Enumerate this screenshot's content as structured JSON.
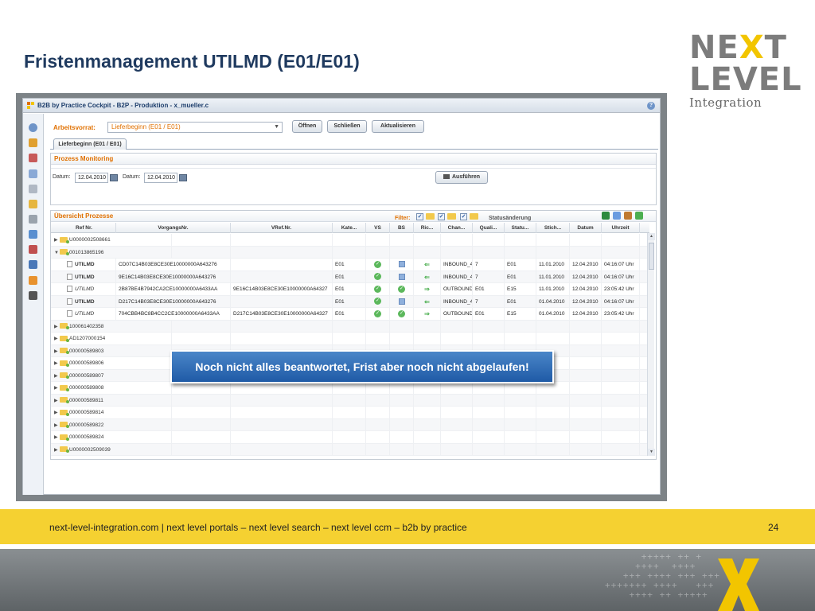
{
  "slide": {
    "title": "Fristenmanagement UTILMD (E01/E01)",
    "logo": {
      "line1_a": "NE",
      "line1_x": "X",
      "line1_b": "T",
      "line2": "LEVEL",
      "line3": "Integration"
    },
    "footer_text": "next-level-integration.com | next level portals –  next level search – next level ccm – b2b by practice",
    "page_number": "24",
    "callout": "Noch nicht alles beantwortet, Frist aber noch nicht abgelaufen!"
  },
  "app": {
    "window_title": "B2B by Practice Cockpit - B2P - Produktion - x_mueller.c",
    "toolbar": {
      "worklist_label": "Arbeitsvorrat:",
      "worklist_value": "Lieferbeginn (E01 / E01)",
      "open_button": "Öffnen",
      "close_button": "Schließen",
      "refresh_button": "Aktualisieren"
    },
    "tab": "Lieferbeginn (E01 / E01)",
    "monitoring": {
      "title": "Prozess Monitoring",
      "date_label_1": "Datum:",
      "date_value_1": "12.04.2010",
      "date_label_2": "Datum:",
      "date_value_2": "12.04.2010",
      "execute_button": "Ausführen"
    },
    "overview": {
      "title": "Übersicht Prozesse",
      "filter_label": "Filter:",
      "status_change_label": "Statusänderung"
    },
    "columns": [
      "Ref Nr.",
      "VorgangsNr.",
      "VRef.Nr.",
      "Kate...",
      "VS",
      "BS",
      "Ric...",
      "Chan...",
      "Quali...",
      "Statu...",
      "Stich...",
      "Datum",
      "Uhrzeit"
    ],
    "rows": [
      {
        "kind": "folder",
        "expanded": false,
        "ref": "U0000002508661"
      },
      {
        "kind": "folder",
        "expanded": true,
        "ref": "001013865196"
      },
      {
        "kind": "doc",
        "style": "bold",
        "ref": "UTILMD",
        "vorgang": "CD07C14B03E8CE30E10000000A643276",
        "vref": "",
        "kat": "E01",
        "vs": "ok",
        "bs": "sq",
        "ric": "in",
        "chan": "INBOUND_4",
        "quali": "7",
        "status": "E01",
        "stich": "11.01.2010",
        "datum": "12.04.2010",
        "uhr": "04:16:07 Uhr"
      },
      {
        "kind": "doc",
        "style": "bold",
        "ref": "UTILMD",
        "vorgang": "9E16C14B03E8CE30E10000000A643276",
        "vref": "",
        "kat": "E01",
        "vs": "ok",
        "bs": "sq",
        "ric": "in",
        "chan": "INBOUND_4",
        "quali": "7",
        "status": "E01",
        "stich": "11.01.2010",
        "datum": "12.04.2010",
        "uhr": "04:16:07 Uhr"
      },
      {
        "kind": "doc",
        "style": "ital",
        "ref": "UTILMD",
        "vorgang": "2B87BE4B7942CA2CE10000000A6433AA",
        "vref": "9E16C14B03E8CE30E10000000A64327",
        "kat": "E01",
        "vs": "ok",
        "bs": "ok",
        "ric": "out",
        "chan": "OUTBOUND",
        "quali": "E01",
        "status": "E15",
        "stich": "11.01.2010",
        "datum": "12.04.2010",
        "uhr": "23:05:42 Uhr"
      },
      {
        "kind": "doc",
        "style": "bold",
        "ref": "UTILMD",
        "vorgang": "D217C14B03E8CE30E10000000A643276",
        "vref": "",
        "kat": "E01",
        "vs": "ok",
        "bs": "sq",
        "ric": "in",
        "chan": "INBOUND_4",
        "quali": "7",
        "status": "E01",
        "stich": "01.04.2010",
        "datum": "12.04.2010",
        "uhr": "04:16:07 Uhr"
      },
      {
        "kind": "doc",
        "style": "ital",
        "ref": "UTILMD",
        "vorgang": "704CBB4BC8B4CC2CE10000000A6433AA",
        "vref": "D217C14B03E8CE30E10000000A64327",
        "kat": "E01",
        "vs": "ok",
        "bs": "ok",
        "ric": "out",
        "chan": "OUTBOUND",
        "quali": "E01",
        "status": "E15",
        "stich": "01.04.2010",
        "datum": "12.04.2010",
        "uhr": "23:05:42 Uhr"
      },
      {
        "kind": "folder",
        "expanded": false,
        "ref": "100061402358"
      },
      {
        "kind": "folder",
        "expanded": false,
        "ref": "AD1207000154"
      },
      {
        "kind": "folder",
        "expanded": false,
        "ref": "000000589803"
      },
      {
        "kind": "folder",
        "expanded": false,
        "ref": "000000589806"
      },
      {
        "kind": "folder",
        "expanded": false,
        "ref": "000000589807"
      },
      {
        "kind": "folder",
        "expanded": false,
        "ref": "000000589808"
      },
      {
        "kind": "folder",
        "expanded": false,
        "ref": "000000589811"
      },
      {
        "kind": "folder",
        "expanded": false,
        "ref": "000000589814"
      },
      {
        "kind": "folder",
        "expanded": false,
        "ref": "000000589822"
      },
      {
        "kind": "folder",
        "expanded": false,
        "ref": "000000589824"
      },
      {
        "kind": "folder",
        "expanded": false,
        "ref": "U0000002509039"
      }
    ],
    "icons": {
      "sidebar": [
        "help-icon",
        "home-icon",
        "chart-icon",
        "document-icon",
        "search-icon",
        "lock-icon",
        "settings-icon",
        "users-icon",
        "user-group-icon",
        "monitor-icon",
        "mail-icon",
        "printer-icon"
      ],
      "toolbar_right": [
        "excel-icon",
        "copy-icon",
        "user-icon",
        "expand-icon"
      ]
    },
    "colors": {
      "accent_orange": "#e07000",
      "title_blue": "#1f3a5f",
      "footer_yellow": "#f5d131",
      "callout_blue": "#1f5aa6"
    }
  }
}
